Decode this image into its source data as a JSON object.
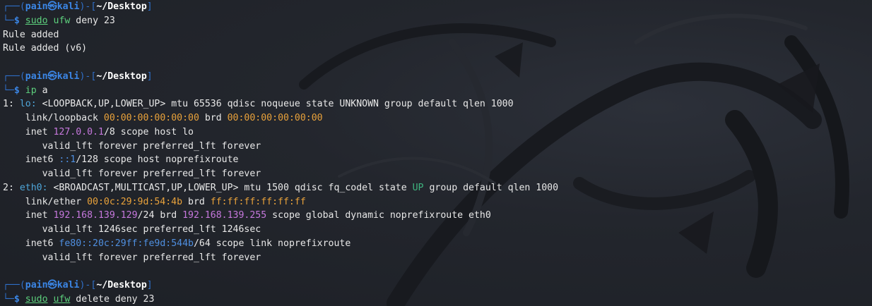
{
  "prompt": {
    "top_left": "┌──(",
    "user": "pain",
    "at": "㉿",
    "host": "kali",
    "mid": ")-[",
    "path": "~/Desktop",
    "end": "]",
    "bottom_left": "└─",
    "dollar": "$ "
  },
  "block1": {
    "sudo": "sudo",
    "ufw": "ufw",
    "args": " deny 23",
    "out1": "Rule added",
    "out2": "Rule added (v6)"
  },
  "block2": {
    "cmd": "ip",
    "args": " a",
    "lo": {
      "index": "1: ",
      "name": "lo:",
      "flags": " <LOOPBACK,UP,LOWER_UP> mtu 65536 qdisc noqueue state UNKNOWN group default qlen 1000",
      "link_prefix": "    link/loopback ",
      "link_mac": "00:00:00:00:00:00",
      "brd_label": " brd ",
      "brd_mac": "00:00:00:00:00:00",
      "inet_prefix": "    inet ",
      "inet_addr": "127.0.0.1",
      "inet_suffix": "/8 scope host lo",
      "valid1": "       valid_lft forever preferred_lft forever",
      "inet6_prefix": "    inet6 ",
      "inet6_addr": "::1",
      "inet6_suffix": "/128 scope host noprefixroute",
      "valid2": "       valid_lft forever preferred_lft forever"
    },
    "eth0": {
      "index": "2: ",
      "name": "eth0:",
      "flags": " <BROADCAST,MULTICAST,UP,LOWER_UP> mtu 1500 qdisc fq_codel state ",
      "state": "UP",
      "flags_rest": " group default qlen 1000",
      "link_prefix": "    link/ether ",
      "link_mac": "00:0c:29:9d:54:4b",
      "brd_label": " brd ",
      "brd_mac": "ff:ff:ff:ff:ff:ff",
      "inet_prefix": "    inet ",
      "inet_addr": "192.168.139.129",
      "inet_mid": "/24 brd ",
      "inet_brd": "192.168.139.255",
      "inet_suffix": " scope global dynamic noprefixroute eth0",
      "valid1": "       valid_lft 1246sec preferred_lft 1246sec",
      "inet6_prefix": "    inet6 ",
      "inet6_addr": "fe80::20c:29ff:fe9d:544b",
      "inet6_suffix": "/64 scope link noprefixroute",
      "valid2": "       valid_lft forever preferred_lft forever"
    }
  },
  "block3": {
    "sudo": "sudo",
    "ufw": "ufw",
    "args": " delete deny 23"
  },
  "colors": {
    "prompt": "#3b86e6",
    "command": "#5dd07d",
    "mac": "#e9a23b",
    "ipv4": "#c678dd",
    "ipv6": "#4f8fe0",
    "state_up": "#3fb37f"
  }
}
